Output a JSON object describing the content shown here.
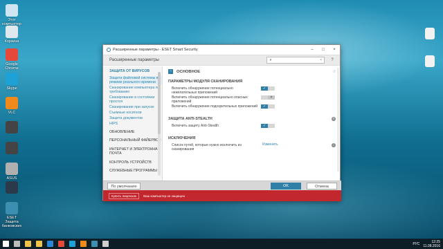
{
  "desktop_icons": [
    {
      "label": "Этот компьютер",
      "color": "#cfe6f2"
    },
    {
      "label": "Корзина",
      "color": "#dfe8ef"
    },
    {
      "label": "Google Chrome",
      "color": "#e5493a"
    },
    {
      "label": "Skype",
      "color": "#1da1d6"
    },
    {
      "label": "VLC",
      "color": "#f08a1b"
    },
    {
      "label": "",
      "color": "#444444"
    },
    {
      "label": "",
      "color": "#444444"
    },
    {
      "label": "ASUS",
      "color": "#b0b0b0"
    },
    {
      "label": "",
      "color": "#2a3a4a"
    },
    {
      "label": "ESET Защита банковских",
      "color": "#3c8fb0"
    }
  ],
  "right_icons": [
    {
      "label": "",
      "color": "#f2f2f2"
    },
    {
      "label": "",
      "color": "#f2f2f2"
    }
  ],
  "window": {
    "title": "Расширенные параметры - ESET Smart Security",
    "minimize": "–",
    "maximize": "□",
    "close": "×"
  },
  "header": {
    "title": "Расширенные параметры",
    "search_placeholder": "",
    "search_icon": "search-icon",
    "clear": "×",
    "help": "?"
  },
  "sidebar": {
    "active_section": "ЗАЩИТА ОТ ВИРУСОВ",
    "sub_items": [
      "Защита файловой системы в режиме реального времени",
      "Сканирование компьютера по требованию",
      "Сканирование в состоянии простоя",
      "Сканирование при запуске",
      "Съемные носители",
      "Защита документов",
      "HIPS"
    ],
    "sections": [
      "ОБНОВЛЕНИЕ",
      "ПЕРСОНАЛЬНЫЙ ФАЙЕРВОЛ",
      "ИНТЕРНЕТ И ЭЛЕКТРОННАЯ ПОЧТА",
      "КОНТРОЛЬ УСТРОЙСТВ",
      "СЛУЖЕБНЫЕ ПРОГРАММЫ"
    ]
  },
  "content": {
    "basic_label": "ОСНОВНОЕ",
    "basic_toggle": "–",
    "reset": "↺",
    "scan_params_title": "ПАРАМЕТРЫ МОДУЛЯ СКАНИРОВАНИЯ",
    "options": [
      {
        "text": "Включить обнаружение потенциально нежелательных приложений",
        "state": "✓",
        "on": true
      },
      {
        "text": "Включить обнаружение потенциально опасных приложений",
        "state": "×",
        "on": false
      },
      {
        "text": "Включить обнаружение подозрительных приложений",
        "state": "✓",
        "on": true
      }
    ],
    "anti_stealth_title": "ЗАЩИТА ANTI-STEALTH",
    "anti_stealth_option": {
      "text": "Включить защиту Anti-Stealth",
      "state": "✓",
      "on": true
    },
    "exclusions_title": "ИСКЛЮЧЕНИЯ",
    "exclusions_text": "Список путей, которые нужно исключить из сканирования",
    "change_link": "Изменить",
    "info": "i"
  },
  "footer": {
    "default_button": "По умолчанию",
    "ok_button": "OK",
    "cancel_button": "Отмена"
  },
  "redbar": {
    "button": "Купить лицензию",
    "text": "Ваш компьютер не защищен"
  },
  "taskbar": {
    "items": [
      "#ffffff",
      "#bbbbbb",
      "#f0c24b",
      "#f0c24b",
      "#2b88d8",
      "#e5493a",
      "#1da1d6",
      "#f08a1b",
      "#3c8fb0",
      "#cfcfcf"
    ],
    "lang": "РУС",
    "time": "12:25",
    "date": "11.08.2016"
  }
}
